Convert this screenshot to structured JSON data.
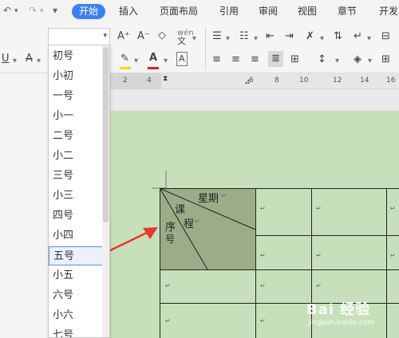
{
  "quick_access": {
    "undo_icon": "↶",
    "redo_icon": "↷",
    "more_icon": "▾"
  },
  "menu": {
    "tabs": [
      {
        "label": "开始",
        "active": true
      },
      {
        "label": "插入"
      },
      {
        "label": "页面布局"
      },
      {
        "label": "引用"
      },
      {
        "label": "审阅"
      },
      {
        "label": "视图"
      },
      {
        "label": "章节"
      },
      {
        "label": "开发"
      }
    ],
    "accent_color": "#3c80f5"
  },
  "ribbon": {
    "font_size_value": "",
    "grow_font": "A⁺",
    "shrink_font": "A⁻",
    "pinyin_guide": "wén",
    "underline": "U",
    "strikethrough": "A",
    "font_color": "A",
    "char_border": "A",
    "font_color_hex": "#e02020",
    "highlight_color_hex": "#f2d51c"
  },
  "font_size_dropdown": {
    "options": [
      "初号",
      "小初",
      "一号",
      "小一",
      "二号",
      "小二",
      "三号",
      "小三",
      "四号",
      "小四",
      "五号",
      "小五",
      "六号",
      "小六",
      "七号"
    ],
    "selected": "五号"
  },
  "ruler": {
    "numbers": [
      "2",
      "4",
      "6",
      "8",
      "10",
      "12",
      "14",
      "16"
    ]
  },
  "document": {
    "page_color": "#c7e0bb",
    "header_cell_color": "#9aad88",
    "header_cell": {
      "weekday": "星期",
      "course": "课",
      "course2": "程",
      "seq": "序",
      "seq2": "号"
    },
    "paragraph_mark": "↵"
  },
  "annotation": {
    "arrow_color": "#e53a2e"
  },
  "watermark": {
    "text": "Bai 经验",
    "url": "jingyan.baidu.com"
  }
}
